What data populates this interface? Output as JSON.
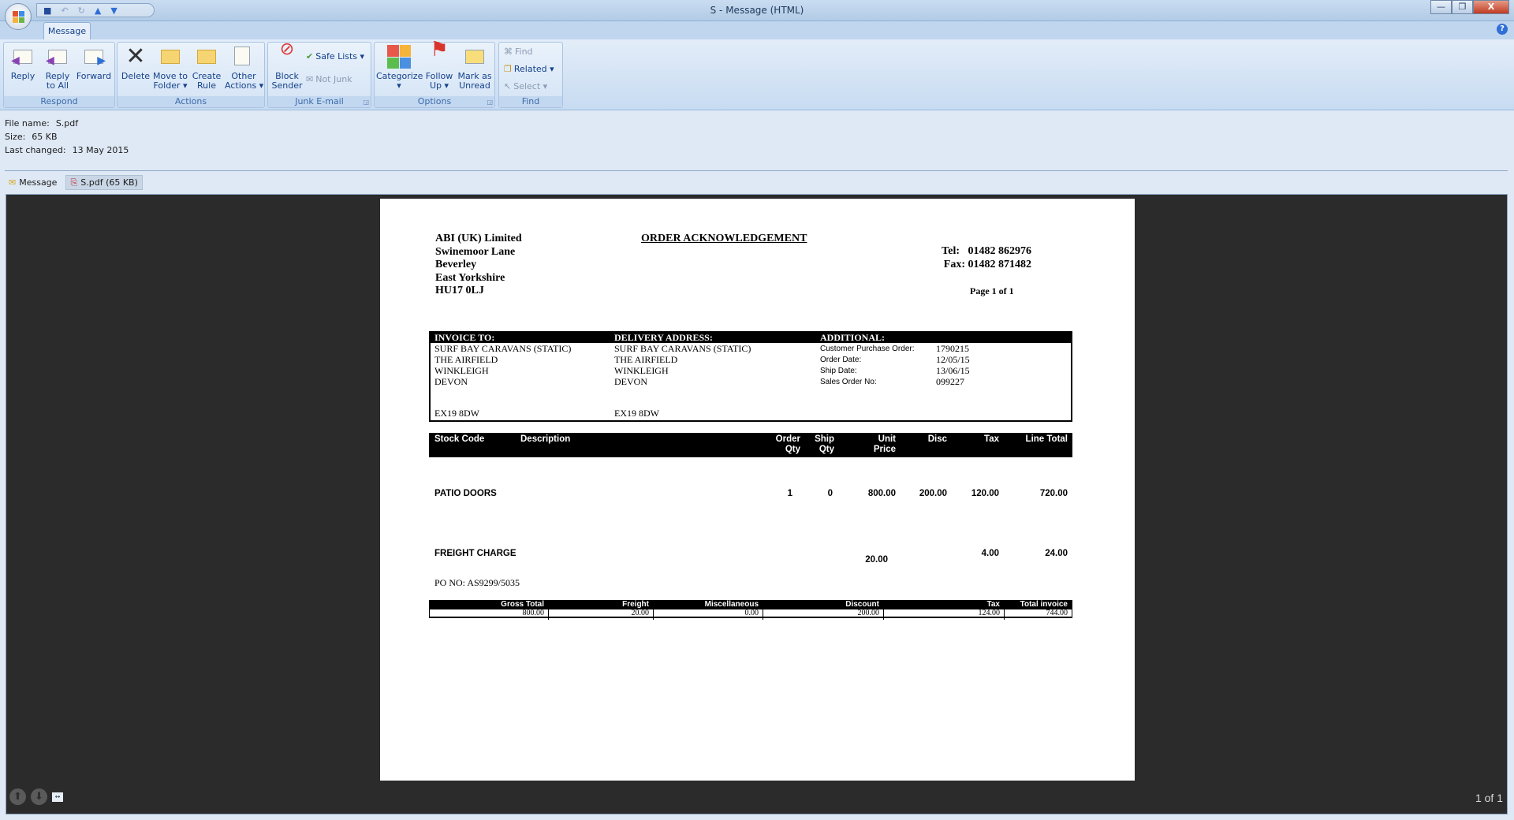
{
  "window": {
    "title": "S - Message (HTML)",
    "minimize": "—",
    "restore": "❐",
    "close": "X",
    "help": "?"
  },
  "tabs": [
    {
      "label": "Message"
    }
  ],
  "ribbon": {
    "groups": [
      {
        "label": "Respond",
        "buttons": [
          "Reply",
          "Reply\nto All",
          "Forward"
        ]
      },
      {
        "label": "Actions",
        "buttons": [
          "Delete",
          "Move to\nFolder ▾",
          "Create\nRule",
          "Other\nActions ▾"
        ]
      },
      {
        "label": "Junk E-mail",
        "buttons": [
          "Block\nSender",
          "Safe Lists ▾",
          "Not Junk"
        ]
      },
      {
        "label": "Options",
        "buttons": [
          "Categorize\n▾",
          "Follow\nUp ▾",
          "Mark as\nUnread"
        ]
      },
      {
        "label": "Find",
        "buttons": [
          "Find",
          "Related ▾",
          "Select ▾"
        ]
      }
    ]
  },
  "file_info": {
    "name_label": "File name:",
    "name": "S.pdf",
    "size_label": "Size:",
    "size": "65 KB",
    "changed_label": "Last changed:",
    "changed": "13 May 2015"
  },
  "attachments": [
    {
      "label": "Message"
    },
    {
      "label": "S.pdf (65 KB)"
    }
  ],
  "document": {
    "company": [
      "ABI (UK) Limited",
      "Swinemoor Lane",
      "Beverley",
      "East Yorkshire",
      "HU17 0LJ"
    ],
    "title": "ORDER ACKNOWLEDGEMENT",
    "tel": "Tel:   01482 862976",
    "fax": "Fax: 01482 871482",
    "page": "Page 1 of 1",
    "invoice_to": {
      "heading": "INVOICE TO:",
      "lines": [
        "SURF BAY CARAVANS (STATIC)",
        "THE AIRFIELD",
        "WINKLEIGH",
        "DEVON"
      ],
      "postcode": "EX19 8DW"
    },
    "delivery": {
      "heading": "DELIVERY ADDRESS:",
      "lines": [
        "SURF BAY CARAVANS (STATIC)",
        "THE AIRFIELD",
        "WINKLEIGH",
        "DEVON"
      ],
      "postcode": "EX19 8DW"
    },
    "additional": {
      "heading": "ADDITIONAL:",
      "labels": [
        "Customer Purchase Order:",
        "Order Date:",
        "Ship Date:",
        "Sales Order No:"
      ],
      "values": [
        "1790215",
        "12/05/15",
        "13/06/15",
        "099227"
      ]
    },
    "items_header": {
      "stock_code": "Stock Code",
      "description": "Description",
      "order_qty": "Order\nQty",
      "ship_qty": "Ship\nQty",
      "unit_price": "Unit\nPrice",
      "disc": "Disc",
      "tax": "Tax",
      "line_total": "Line Total"
    },
    "items": [
      {
        "stock_code": "PATIO DOORS",
        "order_qty": "1",
        "ship_qty": "0",
        "unit_price": "800.00",
        "disc": "200.00",
        "tax": "120.00",
        "line_total": "720.00"
      },
      {
        "stock_code": "FREIGHT CHARGE",
        "unit_price": "20.00",
        "tax": "4.00",
        "line_total": "24.00"
      }
    ],
    "po_no": "PO NO: AS9299/5035",
    "totals": {
      "labels": [
        "Gross Total",
        "Freight",
        "Miscellaneous",
        "Discount",
        "Tax",
        "Total invoice"
      ],
      "values": [
        "800.00",
        "20.00",
        "0.00",
        "200.00",
        "124.00",
        "744.00"
      ]
    }
  },
  "viewer": {
    "page_count": "1 of 1"
  }
}
